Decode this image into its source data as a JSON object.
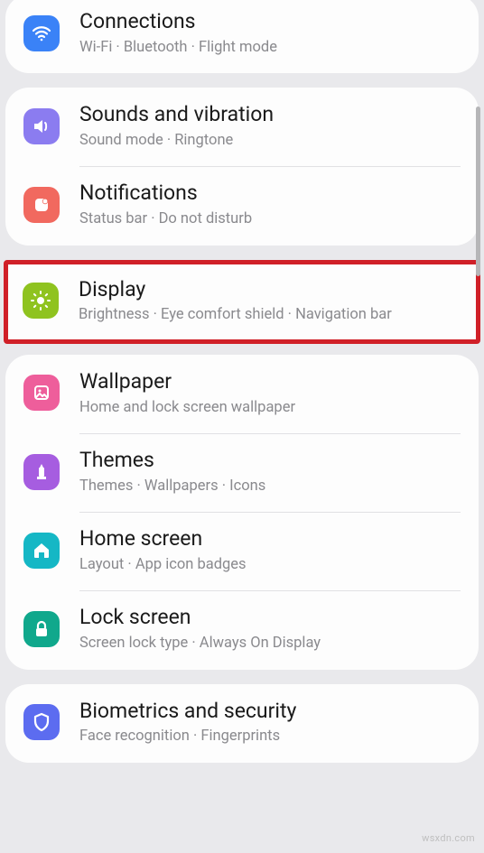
{
  "group0": {
    "items": [
      {
        "title": "Connections",
        "sub": "Wi-Fi  ·  Bluetooth  ·  Flight mode"
      }
    ]
  },
  "group1": {
    "items": [
      {
        "title": "Sounds and vibration",
        "sub": "Sound mode  ·  Ringtone"
      },
      {
        "title": "Notifications",
        "sub": "Status bar  ·  Do not disturb"
      }
    ]
  },
  "highlight": {
    "title": "Display",
    "sub": "Brightness  ·  Eye comfort shield  ·  Navigation bar"
  },
  "group2": {
    "items": [
      {
        "title": "Wallpaper",
        "sub": "Home and lock screen wallpaper"
      },
      {
        "title": "Themes",
        "sub": "Themes  ·  Wallpapers  ·  Icons"
      },
      {
        "title": "Home screen",
        "sub": "Layout  ·  App icon badges"
      },
      {
        "title": "Lock screen",
        "sub": "Screen lock type  ·  Always On Display"
      }
    ]
  },
  "group3": {
    "items": [
      {
        "title": "Biometrics and security",
        "sub": "Face recognition  ·  Fingerprints"
      }
    ]
  },
  "watermark": "wsxdn.com"
}
